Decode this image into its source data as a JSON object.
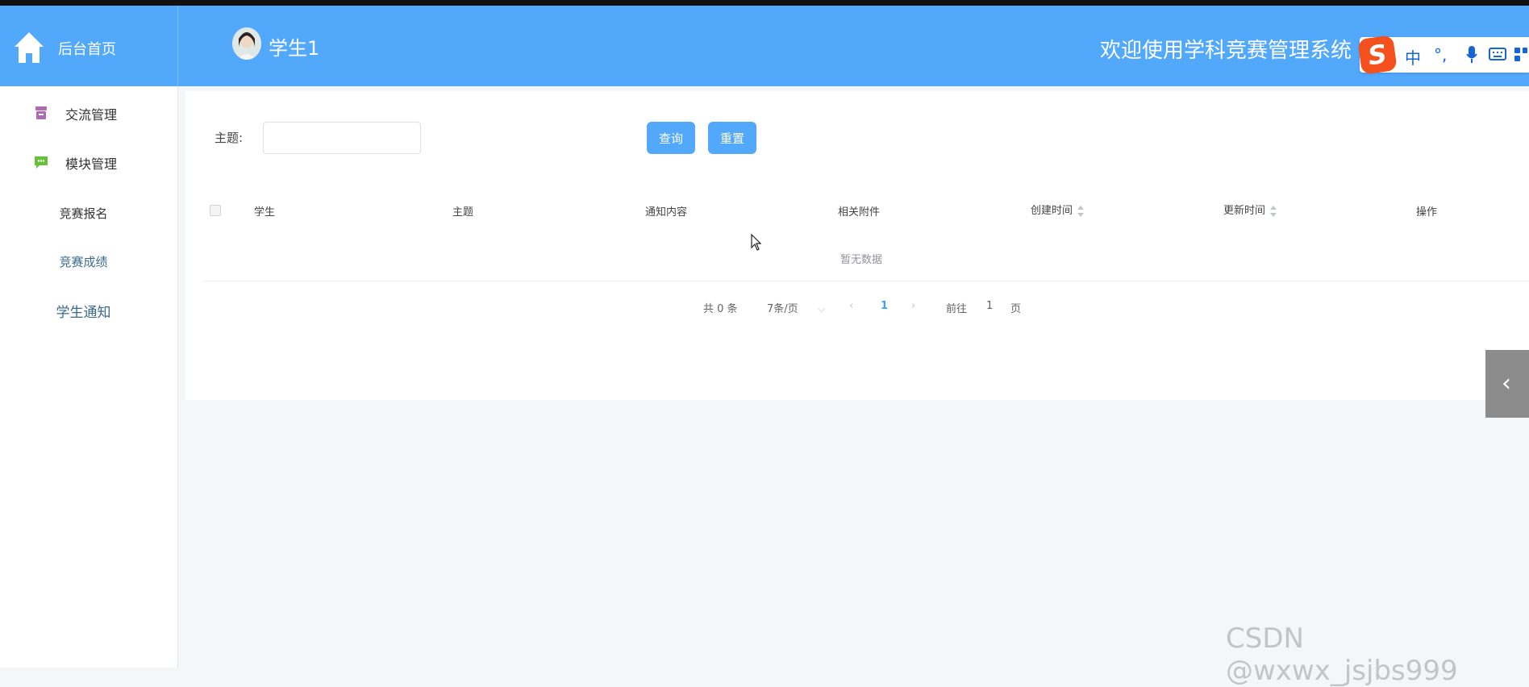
{
  "header": {
    "home_label": "后台首页",
    "user_name": "学生1",
    "welcome": "欢迎使用学科竞赛管理系统",
    "bg_color": "#52a8fb"
  },
  "ime": {
    "logo": "S",
    "items": [
      "中",
      "°,"
    ]
  },
  "sidebar": {
    "items": [
      {
        "label": "交流管理",
        "icon": "archive-icon"
      },
      {
        "label": "模块管理",
        "icon": "chat-icon"
      }
    ],
    "subitems": [
      {
        "label": "竞赛报名"
      },
      {
        "label": "竞赛成绩"
      },
      {
        "label": "学生通知"
      }
    ]
  },
  "filter": {
    "label": "主题:",
    "value": "",
    "query_button": "查询",
    "reset_button": "重置"
  },
  "table": {
    "headers": [
      "学生",
      "主题",
      "通知内容",
      "相关附件",
      "创建时间",
      "更新时间",
      "操作"
    ],
    "empty_text": "暂无数据"
  },
  "pagination": {
    "total": "共 0 条",
    "page_size": "7条/页",
    "current_page": "1",
    "goto_label": "前往",
    "goto_value": "1",
    "page_suffix": "页"
  },
  "watermark": "CSDN @wxwx_jsjbs999"
}
